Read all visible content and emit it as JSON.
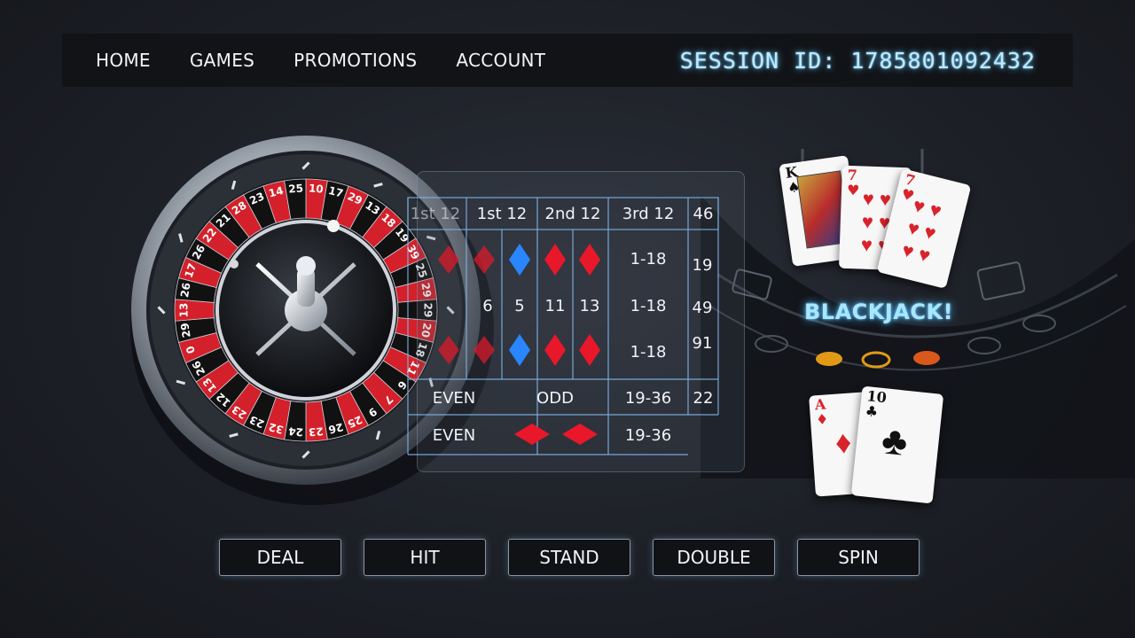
{
  "nav": {
    "items": [
      {
        "label": "HOME"
      },
      {
        "label": "GAMES"
      },
      {
        "label": "PROMOTIONS"
      },
      {
        "label": "ACCOUNT"
      }
    ],
    "session": "SESSION ID: 1785801092432"
  },
  "roulette": {
    "pocket_numbers": [
      "10",
      "17",
      "29",
      "13",
      "18",
      "19",
      "39",
      "25",
      "29",
      "29",
      "20",
      "18",
      "11",
      "6",
      "7",
      "9",
      "25",
      "26",
      "23",
      "24",
      "32",
      "23",
      "23",
      "12",
      "13",
      "26",
      "0",
      "29",
      "13",
      "26",
      "17",
      "26",
      "22",
      "21",
      "28",
      "23",
      "14",
      "25"
    ],
    "pocket_colors": [
      "#d4202a",
      "#111111"
    ]
  },
  "betting_table": {
    "header": [
      "1st 12",
      "1st 12",
      "2nd 12",
      "3rd 12",
      "46"
    ],
    "row1": [
      "1-18",
      "19"
    ],
    "row2": [
      "6",
      "5",
      "11",
      "13",
      "1-18",
      "49"
    ],
    "row3": [
      "1-18",
      "91"
    ],
    "row4": [
      "EVEN",
      "ODD",
      "19-36",
      "22"
    ],
    "row5": [
      "EVEN",
      "19-36"
    ],
    "diamond_colors": {
      "red": "#e8182a",
      "blue": "#2a86ff"
    }
  },
  "blackjack": {
    "label": "BLACKJACK!",
    "dealer_cards": [
      {
        "rank": "K",
        "suit": "♠",
        "suit_name": "spade"
      },
      {
        "rank": "7",
        "suit": "♥",
        "suit_name": "heart"
      },
      {
        "rank": "7",
        "suit": "♥",
        "suit_name": "heart"
      }
    ],
    "player_cards": [
      {
        "rank": "A",
        "suit": "♦",
        "suit_name": "diamond"
      },
      {
        "rank": "10",
        "suit": "♣",
        "suit_name": "club"
      }
    ]
  },
  "controls": {
    "buttons": [
      {
        "label": "DEAL"
      },
      {
        "label": "HIT"
      },
      {
        "label": "STAND"
      },
      {
        "label": "DOUBLE"
      },
      {
        "label": "SPIN"
      }
    ]
  }
}
